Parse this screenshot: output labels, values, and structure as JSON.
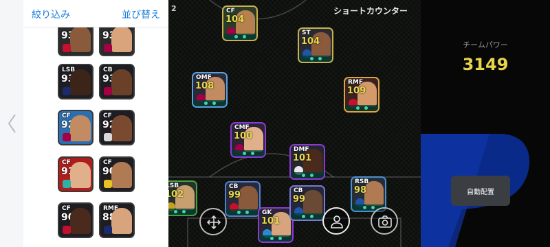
{
  "header": {
    "filter_label": "絞り込み",
    "sort_label": "並び替え"
  },
  "list_cards": [
    {
      "pos": "",
      "rating": "93",
      "bg": "#2b2b2b",
      "face": "#8a5a3c",
      "badge": "#c8102e"
    },
    {
      "pos": "",
      "rating": "93",
      "bg": "#2b2b2b",
      "face": "#d9a47c",
      "badge": "#a50044"
    },
    {
      "pos": "LSB",
      "rating": "93",
      "bg": "#1d1d22",
      "face": "#3c2418",
      "badge": "#1b2a6b"
    },
    {
      "pos": "CB",
      "rating": "93",
      "bg": "#1d1d22",
      "face": "#6a4028",
      "badge": "#a50044"
    },
    {
      "pos": "CF",
      "rating": "92",
      "bg": "#2c6fb0",
      "face": "#c38b62",
      "badge": "#a50044"
    },
    {
      "pos": "CF",
      "rating": "92",
      "bg": "#1d1d22",
      "face": "#7a4a30",
      "badge": "#d8d8d8"
    },
    {
      "pos": "CF",
      "rating": "91",
      "bg": "#b01d1d",
      "face": "#e0b08a",
      "badge": "#2ab3a6"
    },
    {
      "pos": "CF",
      "rating": "90",
      "bg": "#1d1d22",
      "face": "#b07a52",
      "badge": "#e8c020"
    },
    {
      "pos": "CF",
      "rating": "90",
      "bg": "#1d1d22",
      "face": "#4a2a1c",
      "badge": "#c2102e"
    },
    {
      "pos": "RMF",
      "rating": "88",
      "bg": "#1d1d22",
      "face": "#d8a47e",
      "badge": "#1a2a6b"
    }
  ],
  "pitch": {
    "formation": "2",
    "tactic": "ショートカウンター",
    "players": [
      {
        "pos": "CF",
        "rating": "104",
        "border": "#c9b24a",
        "bg": "#2a3b2a",
        "face": "#b7814e",
        "badge": "#a50044"
      },
      {
        "pos": "ST",
        "rating": "104",
        "border": "#c9b24a",
        "bg": "#2a2a32",
        "face": "#8a5a3c",
        "badge": "#1f56a8"
      },
      {
        "pos": "OMF",
        "rating": "108",
        "border": "#5aa0e0",
        "bg": "#2a2a38",
        "face": "#c38b62",
        "badge": "#a50044"
      },
      {
        "pos": "RMF",
        "rating": "109",
        "border": "#e0a43a",
        "bg": "#3a2222",
        "face": "#d59a6a",
        "badge": "#c8102e"
      },
      {
        "pos": "CMF",
        "rating": "100",
        "border": "#8b3ad6",
        "bg": "#2a2436",
        "face": "#e0b08a",
        "badge": "#a50044"
      },
      {
        "pos": "DMF",
        "rating": "101",
        "border": "#8b3ad6",
        "bg": "#262632",
        "face": "#4a2a1c",
        "badge": "#e8e8e8"
      },
      {
        "pos": "LSB",
        "rating": "102",
        "border": "#4aa040",
        "bg": "#26322a",
        "face": "#c8a070",
        "badge": "#c8a020"
      },
      {
        "pos": "CB",
        "rating": "99",
        "border": "#5080d0",
        "bg": "#262a3a",
        "face": "#8a5a3c",
        "badge": "#c8102e"
      },
      {
        "pos": "GK",
        "rating": "101",
        "border": "#8b3ad6",
        "bg": "#2a2636",
        "face": "#d8a47e",
        "badge": "#2a8ad0"
      },
      {
        "pos": "CB",
        "rating": "99",
        "border": "#7a7ad0",
        "bg": "#26263a",
        "face": "#6a4a34",
        "badge": "#1f56a8"
      },
      {
        "pos": "RSB",
        "rating": "98",
        "border": "#4a90d0",
        "bg": "#262e3a",
        "face": "#b07a52",
        "badge": "#1f56a8"
      }
    ]
  },
  "right_panel": {
    "team_power_label": "チームパワー",
    "team_power_value": "3149",
    "auto_assign_label": "自動配置"
  },
  "icons": {
    "back": "chevron-left-icon",
    "move": "move-arrows-icon",
    "person": "person-icon",
    "camera": "camera-icon"
  },
  "colors": {
    "accent_link": "#1d7fd8",
    "power_yellow": "#e8d64a"
  }
}
